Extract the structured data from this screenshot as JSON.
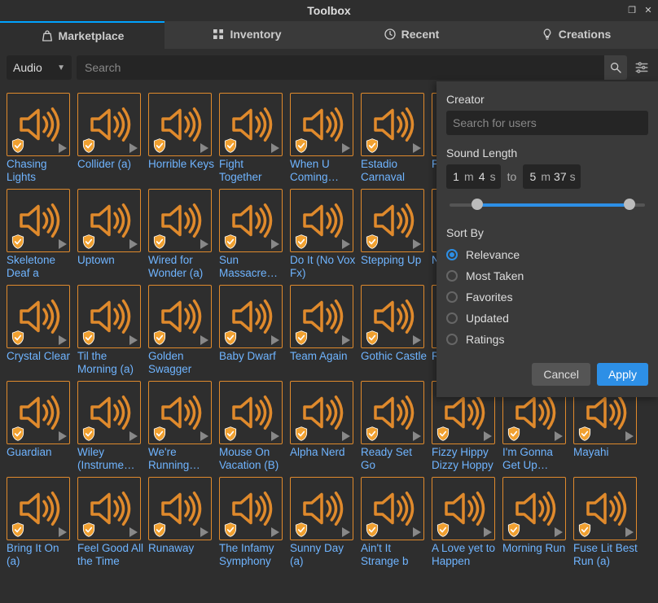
{
  "window": {
    "title": "Toolbox"
  },
  "tabs": [
    {
      "id": "marketplace",
      "label": "Marketplace",
      "icon": "bag-icon",
      "active": true
    },
    {
      "id": "inventory",
      "label": "Inventory",
      "icon": "grid-icon",
      "active": false
    },
    {
      "id": "recent",
      "label": "Recent",
      "icon": "clock-icon",
      "active": false
    },
    {
      "id": "creations",
      "label": "Creations",
      "icon": "bulb-icon",
      "active": false
    }
  ],
  "category": {
    "selected": "Audio"
  },
  "search": {
    "placeholder": "Search"
  },
  "grid": {
    "items": [
      "Chasing Lights",
      "Collider (a)",
      "Horrible Keys",
      "Fight Together",
      "When U Coming…",
      "Estadio Carnaval",
      "Phar…",
      "",
      "",
      "Skeletone Deaf a",
      "Uptown",
      "Wired for Wonder (a)",
      "Sun Massacre…",
      "Do It (No Vox Fx)",
      "Stepping Up",
      "Nigh…",
      "",
      "",
      "Crystal Clear",
      "Til the Morning (a)",
      "Golden Swagger",
      "Baby Dwarf",
      "Team Again",
      "Gothic Castle",
      "Restl…",
      "",
      "",
      "Guardian",
      "Wiley (Instrume…",
      "We're Running…",
      "Mouse On Vacation (B)",
      "Alpha Nerd",
      "Ready Set Go",
      "Fizzy Hippy Dizzy Hoppy",
      "I'm Gonna Get Up…",
      "Mayahi",
      "Bring It On (a)",
      "Feel Good All the Time",
      "Runaway",
      "The Infamy Symphony",
      "Sunny Day (a)",
      "Ain't It Strange b",
      "A Love yet to Happen",
      "Morning Run",
      "Fuse Lit Best Run (a)"
    ]
  },
  "filter_panel": {
    "creator": {
      "label": "Creator",
      "placeholder": "Search for users"
    },
    "sound_length": {
      "label": "Sound Length",
      "from": {
        "m": "1",
        "s": "4"
      },
      "to": {
        "m": "5",
        "s": "37"
      },
      "to_word": "to"
    },
    "sort_by": {
      "label": "Sort By",
      "options": [
        {
          "label": "Relevance",
          "checked": true
        },
        {
          "label": "Most Taken",
          "checked": false
        },
        {
          "label": "Favorites",
          "checked": false
        },
        {
          "label": "Updated",
          "checked": false
        },
        {
          "label": "Ratings",
          "checked": false
        }
      ]
    },
    "buttons": {
      "cancel": "Cancel",
      "apply": "Apply"
    }
  }
}
